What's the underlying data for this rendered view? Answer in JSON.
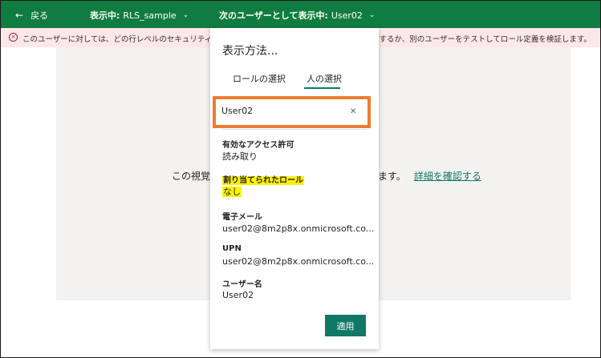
{
  "topbar": {
    "back_label": "戻る",
    "view_prefix": "表示中:",
    "view_value": "RLS_sample",
    "viewas_prefix": "次のユーザーとして表示中:",
    "viewas_value": "User02"
  },
  "warning": {
    "text_left": "このユーザーに対しては、どの行レベルのセキュリティ ロ",
    "text_right": "加するか、別のユーザーをテストしてロール定義を検証します。"
  },
  "canvas": {
    "message_left": "この視覚",
    "message_right": "ます。",
    "link_label": "詳細を確認する"
  },
  "panel": {
    "title": "表示方法...",
    "tabs": [
      {
        "label": "ロールの選択",
        "active": false
      },
      {
        "label": "人の選択",
        "active": true
      }
    ],
    "search_value": "User02",
    "fields": [
      {
        "label": "有効なアクセス許可",
        "value": "読み取り"
      },
      {
        "label": "割り当てられたロール",
        "value": "なし"
      },
      {
        "label": "電子メール",
        "value": "user02@8m2p8x.onmicrosoft.co..."
      },
      {
        "label": "UPN",
        "value": "user02@8m2p8x.onmicrosoft.co..."
      },
      {
        "label": "ユーザー名",
        "value": "User02"
      }
    ],
    "apply_label": "適用"
  },
  "colors": {
    "header_bg": "#107c41",
    "accent": "#117865",
    "warning_bg": "#fde7e9",
    "highlight": "#fff200",
    "annotation_border": "#ed7d31"
  }
}
